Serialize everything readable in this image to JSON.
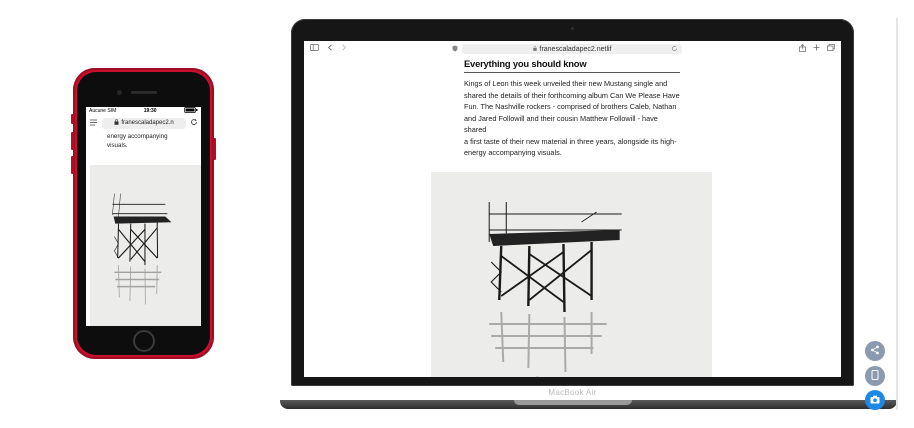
{
  "phone": {
    "status_carrier": "Aucune SIM",
    "status_time": "19:30",
    "url": "franescaladapec2.n",
    "text_lines": [
      "energy accompanying",
      "visuals."
    ]
  },
  "laptop": {
    "url": "franescaladapec2.netlif",
    "brand": "MacBook Air",
    "article": {
      "title": "Everything you should know",
      "body_lines": [
        "Kings of Leon this week unveiled their new Mustang single and",
        "shared the details of their forthcoming album Can We Please Have",
        "Fun. The Nashville rockers - comprised of brothers Caleb, Nathan",
        "and Jared Followill and their cousin Matthew Followill - have shared",
        "a first taste of their new material in three years, alongside its high-",
        "energy accompanying visuals."
      ]
    }
  },
  "floating_buttons": {
    "share_icon": "share-icon",
    "device_icon": "mobile-device-icon",
    "camera_icon": "camera-icon",
    "share_color": "#8a9bb0",
    "device_color": "#8a9bb0",
    "camera_color": "#1e88e5"
  }
}
